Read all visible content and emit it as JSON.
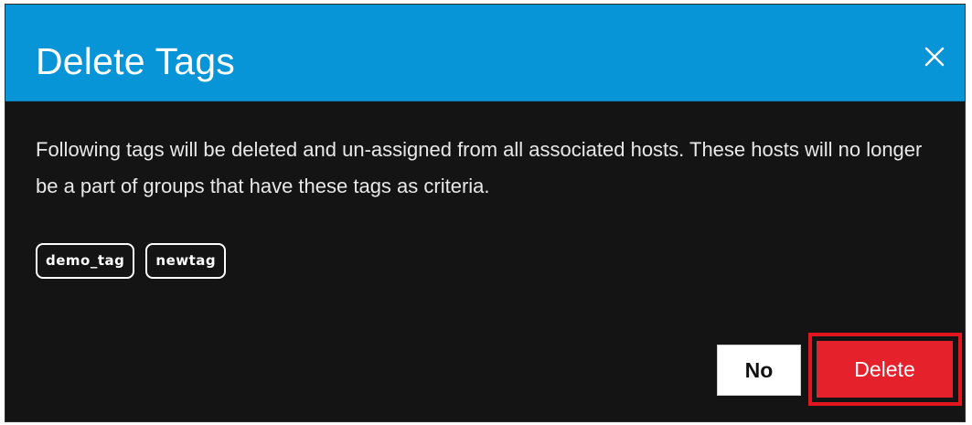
{
  "dialog": {
    "title": "Delete Tags",
    "close_icon": "close-icon",
    "message": "Following tags will be deleted and un-assigned from all associated hosts. These hosts will no longer be a part of groups that have these tags as criteria.",
    "tags": [
      "demo_tag",
      "newtag"
    ],
    "buttons": {
      "no_label": "No",
      "delete_label": "Delete"
    }
  },
  "colors": {
    "header": "#0895d8",
    "body": "#141414",
    "delete_button": "#e5222b",
    "highlight": "#e3161f"
  }
}
